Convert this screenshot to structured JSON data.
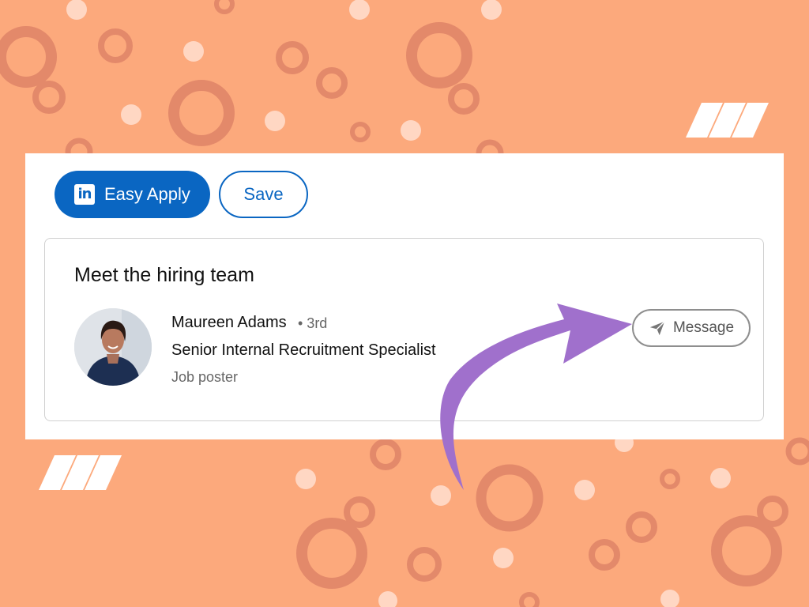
{
  "job_actions": {
    "easy_apply_label": "Easy Apply",
    "save_label": "Save"
  },
  "hiring_team": {
    "title": "Meet the hiring team",
    "person": {
      "name": "Maureen Adams",
      "connection_degree": "• 3rd",
      "role": "Senior Internal Recruitment Specialist",
      "tag": "Job poster"
    },
    "message_label": "Message"
  },
  "icons": {
    "linkedin_logo": "linkedin-logo-icon",
    "message": "send-icon",
    "annotation": "curved-arrow"
  },
  "colors": {
    "background": "#FCA97C",
    "bubble": "#E3896A",
    "dot": "#FFD7C3",
    "linkedin_blue": "#0A66C2",
    "arrow": "#A070CC"
  }
}
